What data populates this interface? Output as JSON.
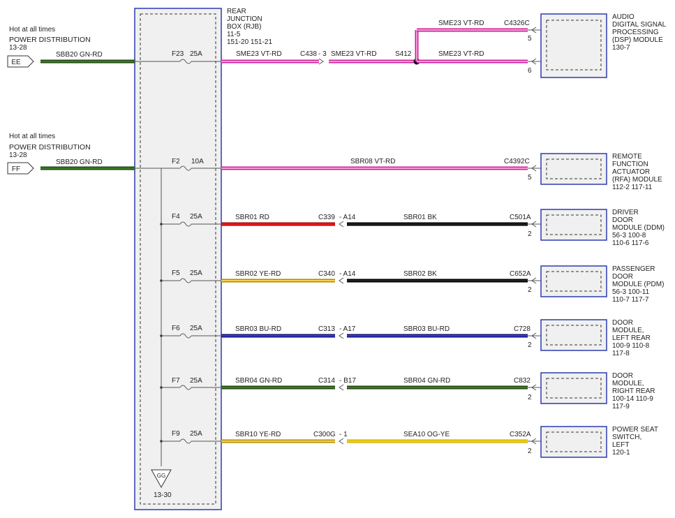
{
  "palette": {
    "vt_rd_main": "#ee66cc",
    "vt_rd_edge": "#cc2299",
    "gn_rd_main": "#2a5e16",
    "gn_rd_edge": "#1a3d0c",
    "rd_main": "#dd1111",
    "bk_main": "#111111",
    "ye_rd_main": "#f0c400",
    "ye_rd_edge": "#b08a00",
    "bu_rd_main": "#2222bb",
    "bu_rd_edge": "#111177",
    "og_ye_main": "#f5d000",
    "og_ye_edge": "#c9a800",
    "box_blue": "#2b3bb0"
  },
  "sources": [
    {
      "key": "ee",
      "hot": "Hot at all times",
      "name": "POWER DISTRIBUTION",
      "ref": "13-28",
      "connector": "EE",
      "wire": "SBB20  GN-RD"
    },
    {
      "key": "ff",
      "hot": "Hot at all times",
      "name": "POWER DISTRIBUTION",
      "ref": "13-28",
      "connector": "FF",
      "wire": "SBB20  GN-RD"
    }
  ],
  "rjb": {
    "title_lines": [
      "REAR",
      "JUNCTION",
      "BOX (RJB)",
      "11-5",
      "151-20  151-21"
    ],
    "ground_label": "GG",
    "ground_ref": "13-30"
  },
  "fuses": [
    {
      "id": "F23",
      "rating": "25A"
    },
    {
      "id": "F2",
      "rating": "10A"
    },
    {
      "id": "F4",
      "rating": "25A"
    },
    {
      "id": "F5",
      "rating": "25A"
    },
    {
      "id": "F6",
      "rating": "25A"
    },
    {
      "id": "F7",
      "rating": "25A"
    },
    {
      "id": "F9",
      "rating": "25A"
    }
  ],
  "dsp": {
    "wire_rjb": "SME23  VT-RD",
    "inline_conn": "C438",
    "inline_pin": "- 3",
    "wire_mid": "SME23  VT-RD",
    "splice": "S412",
    "wire_top": "SME23  VT-RD",
    "wire_bottom": "SME23  VT-RD",
    "module_conn": "C4326C",
    "pin_top": "5",
    "pin_bottom": "6",
    "module_lines": [
      "AUDIO",
      "DIGITAL SIGNAL",
      "PROCESSING",
      "(DSP) MODULE",
      "130-7"
    ]
  },
  "rfa": {
    "wire": "SBR08  VT-RD",
    "module_conn": "C4392C",
    "pin": "5",
    "module_lines": [
      "REMOTE",
      "FUNCTION",
      "ACTUATOR",
      "(RFA) MODULE",
      "112-2    117-11"
    ]
  },
  "circuits": [
    {
      "wire_left": "SBR01  RD",
      "inline_conn": "C339",
      "inline_pin": "- A14",
      "wire_right": "SBR01  BK",
      "module_conn": "C501A",
      "pin": "2",
      "module_lines": [
        "DRIVER",
        "DOOR",
        "MODULE (DDM)",
        "56-3     100-8",
        "110-6   117-6"
      ]
    },
    {
      "wire_left": "SBR02  YE-RD",
      "inline_conn": "C340",
      "inline_pin": "- A14",
      "wire_right": "SBR02  BK",
      "module_conn": "C652A",
      "pin": "2",
      "module_lines": [
        "PASSENGER",
        "DOOR",
        "MODULE (PDM)",
        "56-3     100-11",
        "110-7   117-7"
      ]
    },
    {
      "wire_left": "SBR03  BU-RD",
      "inline_conn": "C313",
      "inline_pin": "- A17",
      "wire_right": "SBR03  BU-RD",
      "module_conn": "C728",
      "pin": "2",
      "module_lines": [
        "DOOR",
        "MODULE,",
        "LEFT REAR",
        "100-9    110-8",
        "117-8"
      ]
    },
    {
      "wire_left": "SBR04  GN-RD",
      "inline_conn": "C314",
      "inline_pin": "- B17",
      "wire_right": "SBR04  GN-RD",
      "module_conn": "C832",
      "pin": "2",
      "module_lines": [
        "DOOR",
        "MODULE,",
        "RIGHT REAR",
        "100-14    110-9",
        "117-9"
      ]
    },
    {
      "wire_left": "SBR10  YE-RD",
      "inline_conn": "C300G",
      "inline_pin": "- 1",
      "wire_right": "SEA10  OG-YE",
      "module_conn": "C352A",
      "pin": "2",
      "module_lines": [
        "POWER SEAT",
        "SWITCH,",
        "LEFT",
        "120-1"
      ]
    }
  ]
}
